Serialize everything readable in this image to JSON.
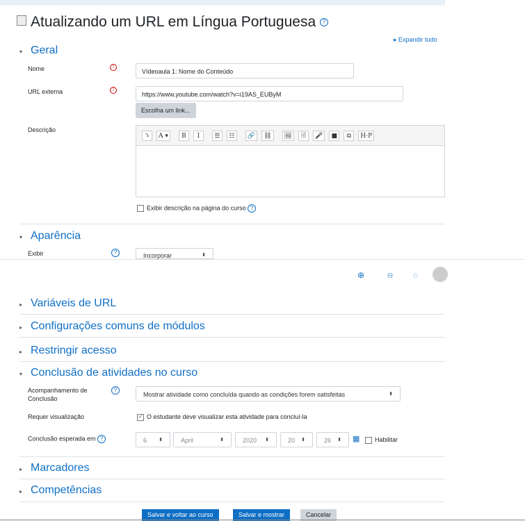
{
  "page_title": "Atualizando um URL em Língua Portuguesa",
  "expand_all": "Expandir tudo",
  "sections": {
    "geral": "Geral",
    "aparencia": "Aparência",
    "variaveis": "Variáveis de URL",
    "config_comuns": "Configurações comuns de módulos",
    "restringir": "Restringir acesso",
    "conclusao": "Conclusão de atividades no curso",
    "marcadores": "Marcadores",
    "competencias": "Competências"
  },
  "fields": {
    "nome_label": "Nome",
    "nome_value": "Vídeoaula 1: Nome do Conteúdo",
    "url_label": "URL externa",
    "url_value": "https://www.youtube.com/watch?v=i19AS_EUByM",
    "choose_link": "Escolha um link...",
    "descricao_label": "Descrição",
    "show_desc": "Exibir descrição na página do curso",
    "exibir_label": "Exibir",
    "exibir_value": "Incorporar"
  },
  "toolbar": [
    "⤵",
    "A ▾",
    "B",
    "I",
    "☰",
    "☷",
    "🔗",
    "⛓",
    "🖼",
    "🗎",
    "🎤",
    "■",
    "⧉",
    "H-P"
  ],
  "completion": {
    "tracking_label_1": "Acompanhamento de",
    "tracking_label_2": "Conclusão",
    "tracking_value": "Mostrar atividade como concluída quando as condições forem satisfeitas",
    "view_label": "Requer visualização",
    "view_text": "O estudante deve visualizar esta atividade para concluí-la",
    "expected_label": "Conclusão esperada em",
    "day": "6",
    "month": "April",
    "year": "2020",
    "hour": "20",
    "minute": "26",
    "enable": "Habilitar"
  },
  "footer": {
    "save_return": "Salvar e voltar ao curso",
    "save_show": "Salvar e mostrar",
    "cancel": "Cancelar"
  },
  "colors": {
    "accent": "#0f6fc5",
    "required": "#cc0000"
  }
}
